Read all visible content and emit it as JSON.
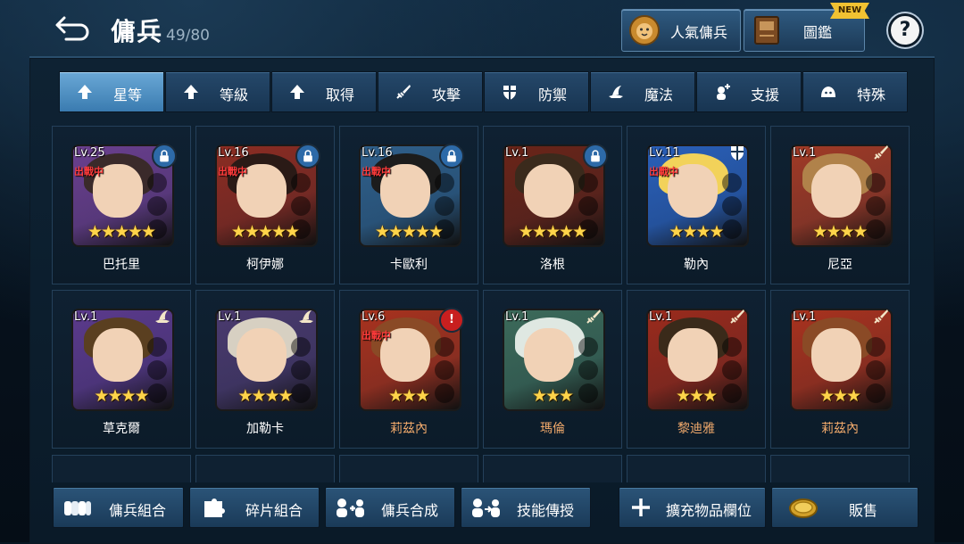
{
  "header": {
    "title": "傭兵",
    "count": "49/80",
    "popular_label": "人氣傭兵",
    "codex_label": "圖鑑",
    "new_badge": "NEW",
    "help_label": "?"
  },
  "tabs": [
    {
      "label": "星等",
      "icon": "arrow-up-icon",
      "selected": true
    },
    {
      "label": "等級",
      "icon": "arrow-up-icon",
      "selected": false
    },
    {
      "label": "取得",
      "icon": "arrow-up-icon",
      "selected": false
    },
    {
      "label": "攻擊",
      "icon": "sword-icon",
      "selected": false
    },
    {
      "label": "防禦",
      "icon": "shield-icon",
      "selected": false
    },
    {
      "label": "魔法",
      "icon": "witch-hat-icon",
      "selected": false
    },
    {
      "label": "支援",
      "icon": "support-icon",
      "selected": false
    },
    {
      "label": "特殊",
      "icon": "slime-icon",
      "selected": false
    }
  ],
  "units": [
    {
      "name": "巴托里",
      "level": "Lv.25",
      "deployed": "出戰中",
      "stars": "★★★★★",
      "badge": "lock-icon",
      "name_color": "#ffffff"
    },
    {
      "name": "柯伊娜",
      "level": "Lv.16",
      "deployed": "出戰中",
      "stars": "★★★★★",
      "badge": "lock-icon",
      "name_color": "#ffffff"
    },
    {
      "name": "卡歐利",
      "level": "Lv.16",
      "deployed": "出戰中",
      "stars": "★★★★★",
      "badge": "lock-icon",
      "name_color": "#ffffff"
    },
    {
      "name": "洛根",
      "level": "Lv.1",
      "deployed": "",
      "stars": "★★★★★",
      "badge": "lock-icon",
      "name_color": "#ffffff"
    },
    {
      "name": "勒內",
      "level": "Lv.11",
      "deployed": "出戰中",
      "stars": "★★★★",
      "badge": "shield-icon",
      "name_color": "#ffffff"
    },
    {
      "name": "尼亞",
      "level": "Lv.1",
      "deployed": "",
      "stars": "★★★★",
      "badge": "sword-icon",
      "name_color": "#ffffff"
    },
    {
      "name": "草克爾",
      "level": "Lv.1",
      "deployed": "",
      "stars": "★★★★",
      "badge": "witch-hat-icon",
      "name_color": "#ffffff"
    },
    {
      "name": "加勒卡",
      "level": "Lv.1",
      "deployed": "",
      "stars": "★★★★",
      "badge": "witch-hat-icon",
      "name_color": "#ffffff"
    },
    {
      "name": "莉茲內",
      "level": "Lv.6",
      "deployed": "出戰中",
      "stars": "★★★",
      "badge": "alert-icon",
      "name_color": "#f0a96b"
    },
    {
      "name": "瑪倫",
      "level": "Lv.1",
      "deployed": "",
      "stars": "★★★",
      "badge": "sword-icon",
      "name_color": "#f0a96b"
    },
    {
      "name": "黎迪雅",
      "level": "Lv.1",
      "deployed": "",
      "stars": "★★★",
      "badge": "sword-icon",
      "name_color": "#f0a96b"
    },
    {
      "name": "莉茲內",
      "level": "Lv.1",
      "deployed": "",
      "stars": "★★★",
      "badge": "sword-icon",
      "name_color": "#f0a96b"
    }
  ],
  "bottom": {
    "combine_label": "傭兵組合",
    "fragment_label": "碎片組合",
    "synthesis_label": "傭兵合成",
    "skill_label": "技能傳授",
    "expand_label": "擴充物品欄位",
    "sell_label": "販售"
  },
  "colors": {
    "accent": "#3a7bb0",
    "star": "#ffd44a",
    "deployed": "#ff3b3b",
    "rare_name": "#f0a96b"
  }
}
